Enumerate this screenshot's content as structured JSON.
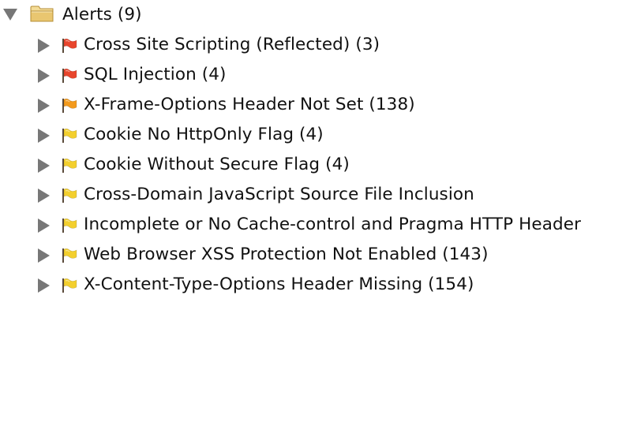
{
  "root": {
    "label": "Alerts (9)",
    "expanded": true,
    "icon": "folder-icon"
  },
  "alerts": [
    {
      "label": "Cross Site Scripting (Reflected) (3)",
      "risk": "high",
      "icon": "flag-icon"
    },
    {
      "label": "SQL Injection (4)",
      "risk": "high",
      "icon": "flag-icon"
    },
    {
      "label": "X-Frame-Options Header Not Set (138)",
      "risk": "medium",
      "icon": "flag-icon"
    },
    {
      "label": "Cookie No HttpOnly Flag (4)",
      "risk": "low",
      "icon": "flag-icon"
    },
    {
      "label": "Cookie Without Secure Flag (4)",
      "risk": "low",
      "icon": "flag-icon"
    },
    {
      "label": "Cross-Domain JavaScript Source File Inclusion",
      "risk": "low",
      "icon": "flag-icon"
    },
    {
      "label": "Incomplete or No Cache-control and Pragma HTTP Header",
      "risk": "low",
      "icon": "flag-icon"
    },
    {
      "label": "Web Browser XSS Protection Not Enabled (143)",
      "risk": "low",
      "icon": "flag-icon"
    },
    {
      "label": "X-Content-Type-Options Header Missing (154)",
      "risk": "low",
      "icon": "flag-icon"
    }
  ],
  "colors": {
    "high": "#e8452c",
    "medium": "#f39a1c",
    "low": "#f3cf2e",
    "toggle": "#777777",
    "folder": "#e9c670"
  }
}
